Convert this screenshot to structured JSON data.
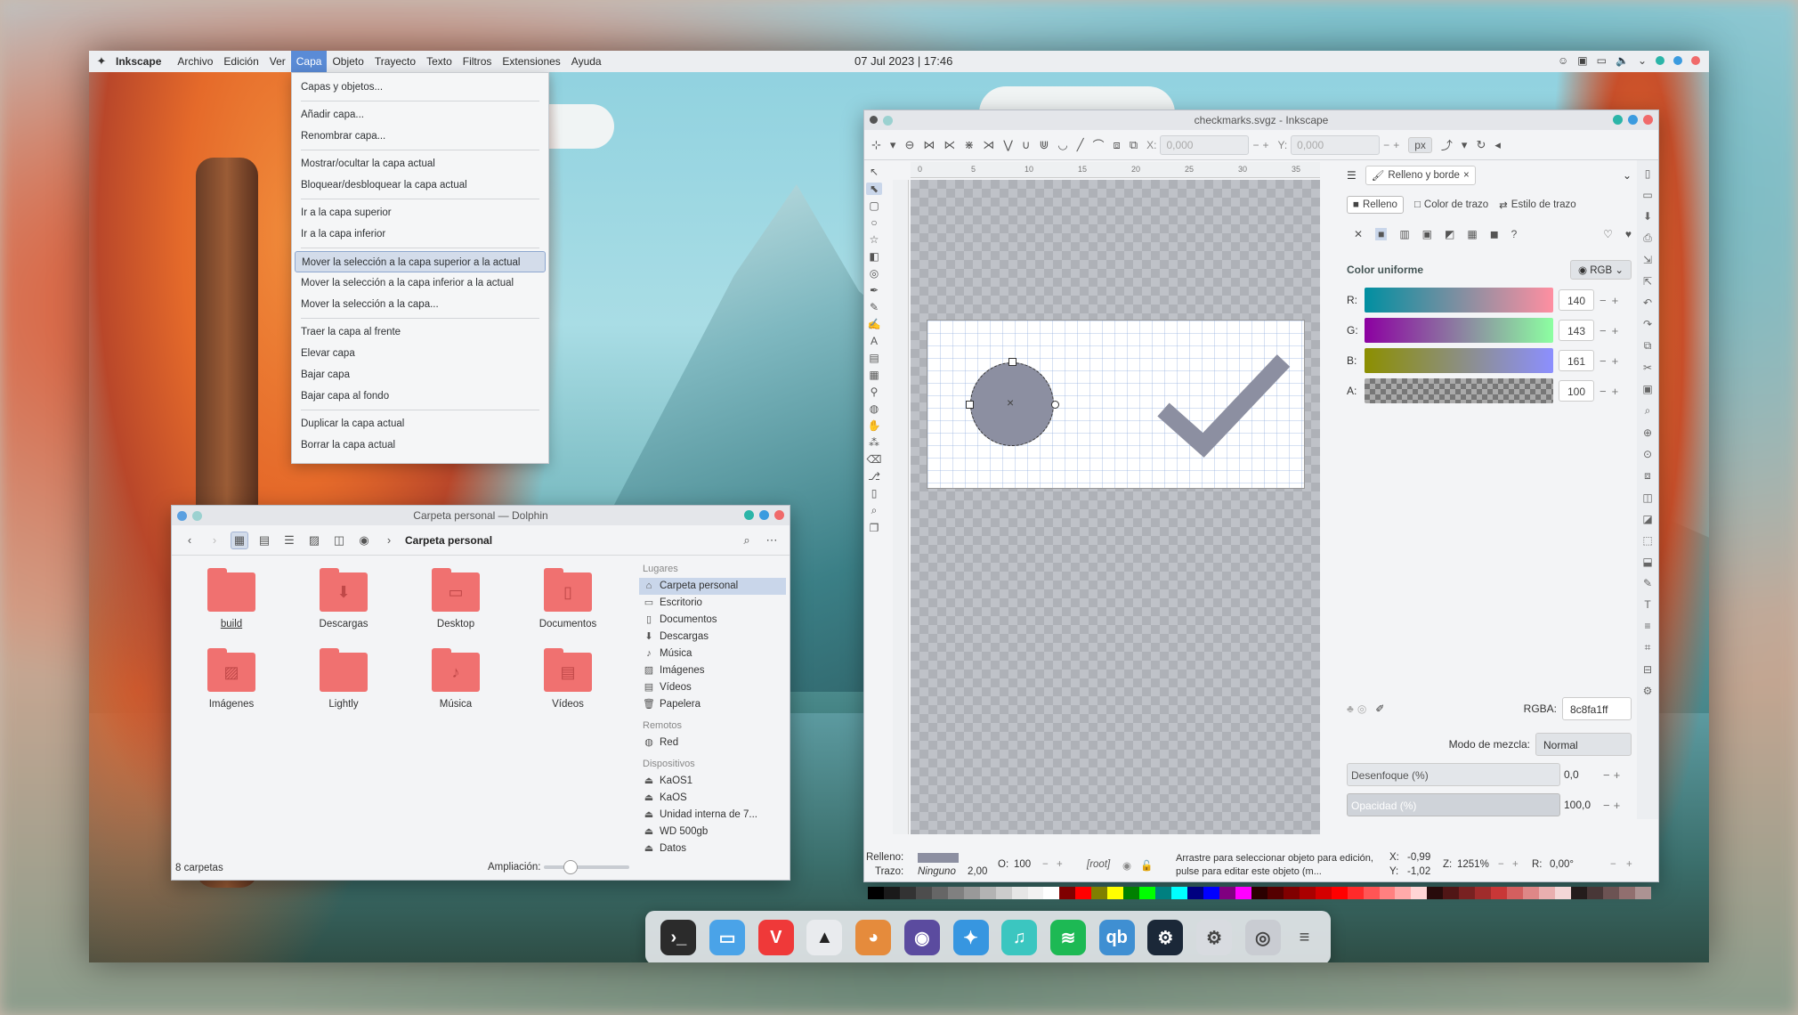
{
  "topbar": {
    "app_name": "Inkscape",
    "menus": [
      "Archivo",
      "Edición",
      "Ver",
      "Capa",
      "Objeto",
      "Trayecto",
      "Texto",
      "Filtros",
      "Extensiones",
      "Ayuda"
    ],
    "clock": "07 Jul 2023 | 17:46"
  },
  "layer_menu": {
    "items": [
      "Capas y objetos...",
      "Añadir capa...",
      "Renombrar capa...",
      "Mostrar/ocultar la capa actual",
      "Bloquear/desbloquear la capa actual",
      "Ir a la capa superior",
      "Ir a la capa inferior",
      "Mover la selección a la capa superior a la actual",
      "Mover la selección a la capa inferior a la actual",
      "Mover la selección a la capa...",
      "Traer la capa al frente",
      "Elevar capa",
      "Bajar capa",
      "Bajar capa al fondo",
      "Duplicar la capa actual",
      "Borrar la capa actual"
    ]
  },
  "dolphin": {
    "title": "Carpeta personal — Dolphin",
    "breadcrumb": "Carpeta personal",
    "folders": [
      "build",
      "Descargas",
      "Desktop",
      "Documentos",
      "Imágenes",
      "Lightly",
      "Música",
      "Vídeos"
    ],
    "places_header": "Lugares",
    "places": [
      "Carpeta personal",
      "Escritorio",
      "Documentos",
      "Descargas",
      "Música",
      "Imágenes",
      "Vídeos",
      "Papelera"
    ],
    "remote_header": "Remotos",
    "remote": [
      "Red"
    ],
    "devices_header": "Dispositivos",
    "devices": [
      "KaOS1",
      "KaOS",
      "Unidad interna de 7...",
      "WD 500gb",
      "Datos"
    ],
    "status": "8 carpetas",
    "zoom_label": "Ampliación:"
  },
  "inkscape": {
    "title": "checkmarks.svgz - Inkscape",
    "x_label": "X:",
    "x_value": "0,000",
    "y_label": "Y:",
    "y_value": "0,000",
    "unit": "px",
    "ruler_ticks": [
      "0",
      "5",
      "10",
      "15",
      "20",
      "25",
      "30",
      "35"
    ],
    "panel_tab": "Relleno y borde",
    "fill_tab": "Relleno",
    "stroke_color_tab": "Color de trazo",
    "stroke_style_tab": "Estilo de trazo",
    "flat_color": "Color uniforme",
    "color_mode": "RGB",
    "channels": [
      {
        "label": "R:",
        "value": "140"
      },
      {
        "label": "G:",
        "value": "143"
      },
      {
        "label": "B:",
        "value": "161"
      },
      {
        "label": "A:",
        "value": "100"
      }
    ],
    "rgba_label": "RGBA:",
    "rgba_value": "8c8fa1ff",
    "blend_label": "Modo de mezcla:",
    "blend_value": "Normal",
    "blur_label": "Desenfoque (%)",
    "blur_value": "0,0",
    "opacity_label": "Opacidad (%)",
    "opacity_value": "100,0",
    "status_fill_label": "Relleno:",
    "status_stroke_label": "Trazo:",
    "status_stroke_value": "Ninguno",
    "status_stroke_width": "2,00",
    "status_o_label": "O:",
    "status_o_value": "100",
    "status_layer": "[root]",
    "status_message": "Arrastre para seleccionar objeto para edición, pulse para editar este objeto (m...",
    "cursor_x_label": "X:",
    "cursor_x": "-0,99",
    "cursor_y_label": "Y:",
    "cursor_y": "-1,02",
    "zoom_label": "Z:",
    "zoom_value": "1251%",
    "rotate_label": "R:",
    "rotate_value": "0,00°",
    "fill_color": "#8c8fa1",
    "swatches": [
      "#000000",
      "#1a1a1a",
      "#333333",
      "#4d4d4d",
      "#666666",
      "#808080",
      "#999999",
      "#b3b3b3",
      "#cccccc",
      "#e6e6e6",
      "#f2f2f2",
      "#ffffff",
      "#800000",
      "#ff0000",
      "#808000",
      "#ffff00",
      "#008000",
      "#00ff00",
      "#008080",
      "#00ffff",
      "#000080",
      "#0000ff",
      "#800080",
      "#ff00ff",
      "#2b0000",
      "#550000",
      "#800000",
      "#aa0000",
      "#d40000",
      "#ff0000",
      "#ff2a2a",
      "#ff5555",
      "#ff8080",
      "#ffaaaa",
      "#ffd5d5",
      "#280b0b",
      "#501616",
      "#782121",
      "#a02c2c",
      "#c83737",
      "#d35f5f",
      "#de8787",
      "#e9afaf",
      "#f4d7d7",
      "#241c1c",
      "#483737",
      "#6c5353",
      "#916f6f",
      "#ac9393"
    ]
  },
  "dock": {
    "apps": [
      "terminal-icon",
      "files-icon",
      "vivaldi-icon",
      "inkscape-icon",
      "gimp-icon",
      "tor-icon",
      "kite-icon",
      "music-icon",
      "spotify-icon",
      "qbittorrent-icon",
      "steam-icon",
      "settings-icon",
      "screenshot-icon",
      "menu-icon"
    ]
  }
}
